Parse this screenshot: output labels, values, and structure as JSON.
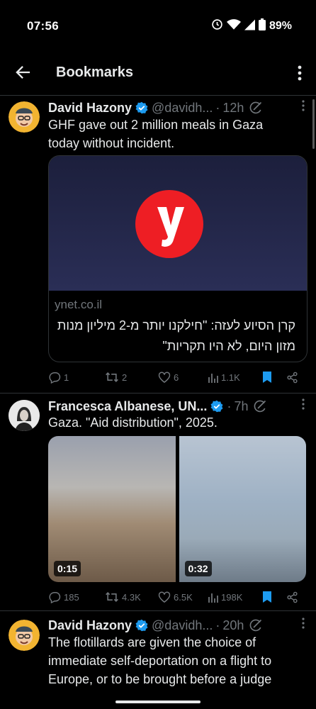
{
  "status_bar": {
    "time": "07:56",
    "battery": "89%"
  },
  "header": {
    "title": "Bookmarks"
  },
  "tweets": [
    {
      "name": "David Hazony",
      "handle": "@davidh...",
      "dot": "·",
      "time": "12h",
      "text": [
        "GHF gave out 2 million meals in Gaza",
        "today without incident."
      ],
      "card": {
        "domain": "ynet.co.il",
        "headline": "קרן הסיוע לעזה: \"חילקנו יותר מ-2 מיליון מנות מזון היום, לא היו תקריות\""
      },
      "stats": {
        "replies": "1",
        "reposts": "2",
        "likes": "6",
        "views": "1.1K"
      }
    },
    {
      "name": "Francesca Albanese, UN...",
      "handle": "",
      "dot": "·",
      "time": "7h",
      "text": [
        "Gaza. \"Aid distribution\", 2025."
      ],
      "media": [
        {
          "duration": "0:15"
        },
        {
          "duration": "0:32"
        }
      ],
      "stats": {
        "replies": "185",
        "reposts": "4.3K",
        "likes": "6.5K",
        "views": "198K"
      }
    },
    {
      "name": "David Hazony",
      "handle": "@davidh...",
      "dot": "·",
      "time": "20h",
      "text": [
        "The flotillards are given the choice of",
        "immediate self-deportation on a flight to",
        "Europe, or to be brought before a judge"
      ]
    }
  ]
}
